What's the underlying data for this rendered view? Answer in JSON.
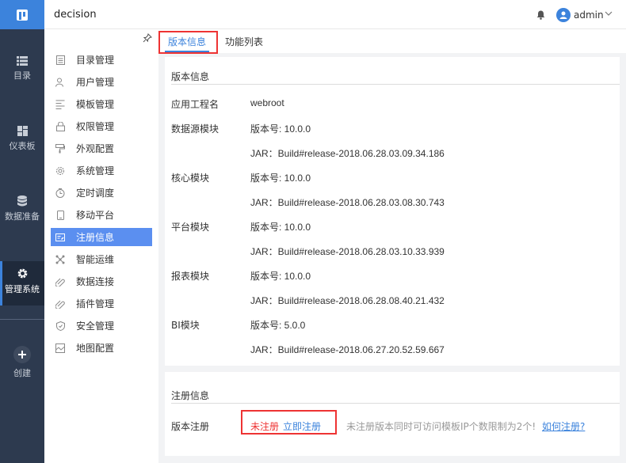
{
  "app": {
    "title": "decision"
  },
  "header": {
    "username": "admin"
  },
  "leftnav": {
    "items": [
      {
        "label": "目录",
        "icon": "list-icon"
      },
      {
        "label": "仪表板",
        "icon": "dashboard-icon"
      },
      {
        "label": "数据准备",
        "icon": "database-icon"
      },
      {
        "label": "管理系统",
        "icon": "gear-icon",
        "active": true
      },
      {
        "label": "创建",
        "icon": "plus-icon"
      }
    ]
  },
  "subnav": {
    "items": [
      {
        "label": "目录管理",
        "icon": "catalog-icon"
      },
      {
        "label": "用户管理",
        "icon": "user-icon"
      },
      {
        "label": "模板管理",
        "icon": "template-icon"
      },
      {
        "label": "权限管理",
        "icon": "lock-icon"
      },
      {
        "label": "外观配置",
        "icon": "paint-icon"
      },
      {
        "label": "系统管理",
        "icon": "settings-icon"
      },
      {
        "label": "定时调度",
        "icon": "timer-icon"
      },
      {
        "label": "移动平台",
        "icon": "mobile-icon"
      },
      {
        "label": "注册信息",
        "icon": "register-icon",
        "active": true
      },
      {
        "label": "智能运维",
        "icon": "ops-icon"
      },
      {
        "label": "数据连接",
        "icon": "link-icon"
      },
      {
        "label": "插件管理",
        "icon": "plugin-icon"
      },
      {
        "label": "安全管理",
        "icon": "shield-icon"
      },
      {
        "label": "地图配置",
        "icon": "map-icon"
      }
    ]
  },
  "tabs": {
    "version": "版本信息",
    "functions": "功能列表"
  },
  "version_card": {
    "title": "版本信息",
    "rows": [
      {
        "label": "应用工程名",
        "value": "webroot"
      },
      {
        "label": "数据源模块",
        "value": "版本号: 10.0.0"
      },
      {
        "label": "",
        "value": "JAR：Build#release-2018.06.28.03.09.34.186"
      },
      {
        "label": "核心模块",
        "value": "版本号: 10.0.0"
      },
      {
        "label": "",
        "value": "JAR：Build#release-2018.06.28.03.08.30.743"
      },
      {
        "label": "平台模块",
        "value": "版本号: 10.0.0"
      },
      {
        "label": "",
        "value": "JAR：Build#release-2018.06.28.03.10.33.939"
      },
      {
        "label": "报表模块",
        "value": "版本号: 10.0.0"
      },
      {
        "label": "",
        "value": "JAR：Build#release-2018.06.28.08.40.21.432"
      },
      {
        "label": "BI模块",
        "value": "版本号: 5.0.0"
      },
      {
        "label": "",
        "value": "JAR：Build#release-2018.06.27.20.52.59.667"
      }
    ]
  },
  "register_card": {
    "title": "注册信息",
    "label": "版本注册",
    "status": "未注册",
    "action": "立即注册",
    "note": "未注册版本同时可访问模板IP个数限制为2个!",
    "help_link": "如何注册?"
  },
  "colors": {
    "accent": "#3c83dc",
    "sidebar": "#2d3a4f",
    "active_subitem": "#5b8ff0",
    "warning": "#e33333"
  }
}
